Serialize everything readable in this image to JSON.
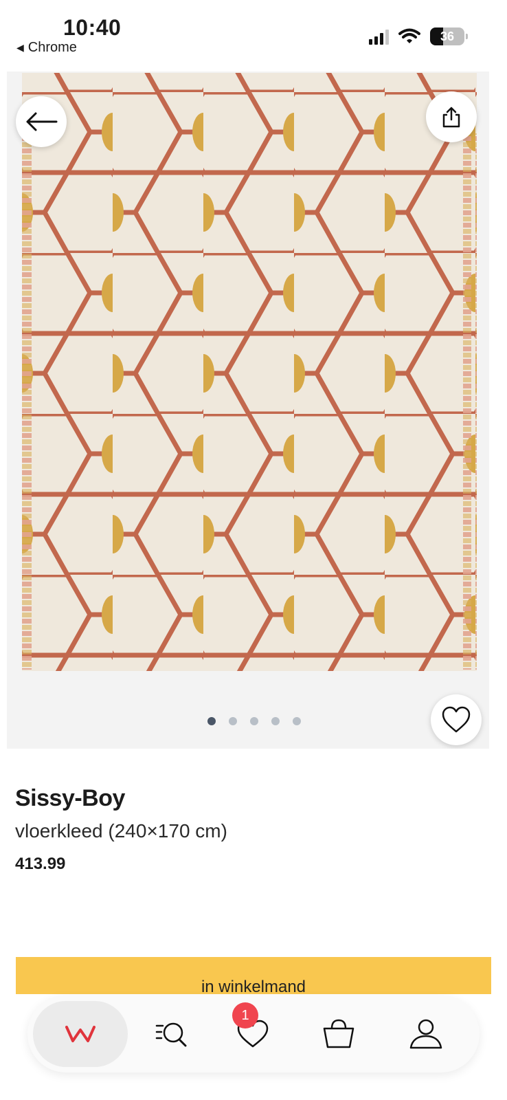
{
  "status_bar": {
    "time": "10:40",
    "back_app_label": "Chrome",
    "battery_level": "36",
    "icons": [
      "signal-icon",
      "wifi-icon",
      "battery-icon"
    ]
  },
  "hero": {
    "image": "rug-product-photo",
    "image_count": 5,
    "active_index": 0,
    "buttons": [
      "back-arrow-icon",
      "share-icon",
      "heart-icon"
    ]
  },
  "product": {
    "brand": "Sissy-Boy",
    "name": "vloerkleed (240×170 cm)",
    "price": "413.99"
  },
  "cart": {
    "label": "in winkelmand",
    "color": "#f9c74f"
  },
  "bottom_nav": {
    "items": [
      {
        "name": "home",
        "icon": "wehkamp-logo-icon",
        "active": true
      },
      {
        "name": "search",
        "icon": "search-list-icon"
      },
      {
        "name": "favorites",
        "icon": "heart-icon",
        "badge": "1"
      },
      {
        "name": "bag",
        "icon": "shopping-bag-icon"
      },
      {
        "name": "account",
        "icon": "user-icon"
      }
    ],
    "accent_color": "#e0343c",
    "badge_color": "#f0454f"
  }
}
